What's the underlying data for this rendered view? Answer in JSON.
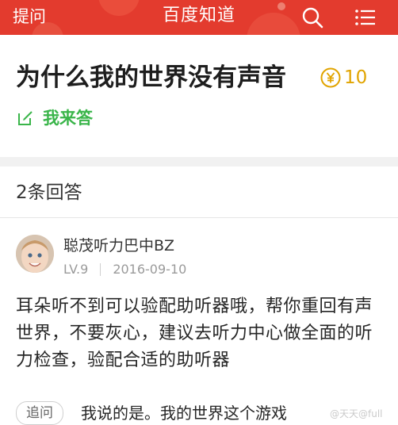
{
  "header": {
    "ask_label": "提问",
    "title": "百度知道",
    "search_icon": "search-icon",
    "menu_icon": "menu-icon",
    "background_color": "#e33b2e"
  },
  "question": {
    "title": "为什么我的世界没有声音",
    "reward_amount": "10",
    "reward_icon": "coin-icon",
    "reward_color": "#e1a400",
    "answer_button_label": "我来答",
    "answer_color": "#3ab54a"
  },
  "answers": {
    "count_label": "2条回答",
    "items": [
      {
        "username": "聪茂听力巴中BZ",
        "level": "LV.9",
        "date": "2016-09-10",
        "content": "耳朵听不到可以验配助听器哦，帮你重回有声世界，不要灰心，建议去听力中心做全面的听力检查，验配合适的助听器",
        "followup_tag": "追问",
        "followup_text": "我说的是。我的世界这个游戏"
      }
    ]
  },
  "watermark": "@天天@full"
}
